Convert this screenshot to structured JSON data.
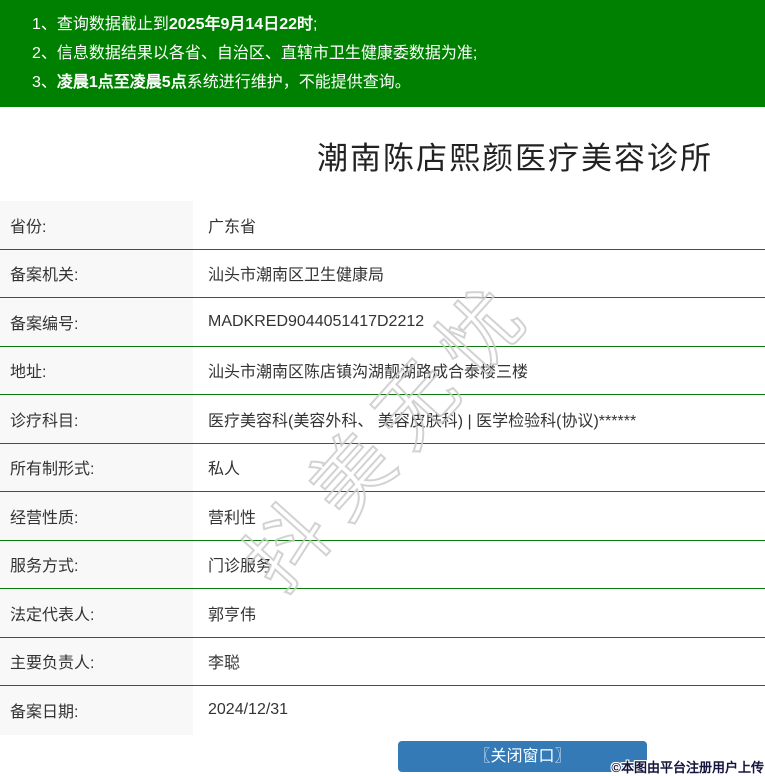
{
  "banner": {
    "bg_color": "#008000",
    "items": [
      {
        "pre": "1、查询数据截止到",
        "bold": "2025年9月14日22时",
        "post": ";"
      },
      {
        "pre": "2、信息数据结果以各省、自治区、直辖市卫生健康委数据为准;",
        "bold": "",
        "post": ""
      },
      {
        "pre": "3、",
        "bold": "凌晨1点至凌晨5点",
        "post": "系统进行维护，不能提供查询。"
      }
    ]
  },
  "title": "潮南陈店熙颜医疗美容诊所",
  "table": {
    "divider_color": "#0a7a0a",
    "label_bg_color": "#f8f8f8",
    "rows": [
      {
        "label": "省份:",
        "value": "广东省"
      },
      {
        "label": "备案机关:",
        "value": "汕头市潮南区卫生健康局"
      },
      {
        "label": "备案编号:",
        "value": "MADKRED9044051417D2212"
      },
      {
        "label": "地址:",
        "value": "汕头市潮南区陈店镇沟湖靓湖路成合泰楼三楼"
      },
      {
        "label": "诊疗科目:",
        "value": "医疗美容科(美容外科、 美容皮肤科) | 医学检验科(协议)******"
      },
      {
        "label": "所有制形式:",
        "value": "私人"
      },
      {
        "label": "经营性质:",
        "value": "营利性"
      },
      {
        "label": "服务方式:",
        "value": "门诊服务"
      },
      {
        "label": "法定代表人:",
        "value": "郭亨伟"
      },
      {
        "label": "主要负责人:",
        "value": "李聪"
      },
      {
        "label": "备案日期:",
        "value": "2024/12/31"
      }
    ]
  },
  "watermark": "抖美无忧",
  "close_button": {
    "label": "〖关闭窗口〗",
    "color": "#337ab7"
  },
  "credit": "©本图由平台注册用户上传"
}
